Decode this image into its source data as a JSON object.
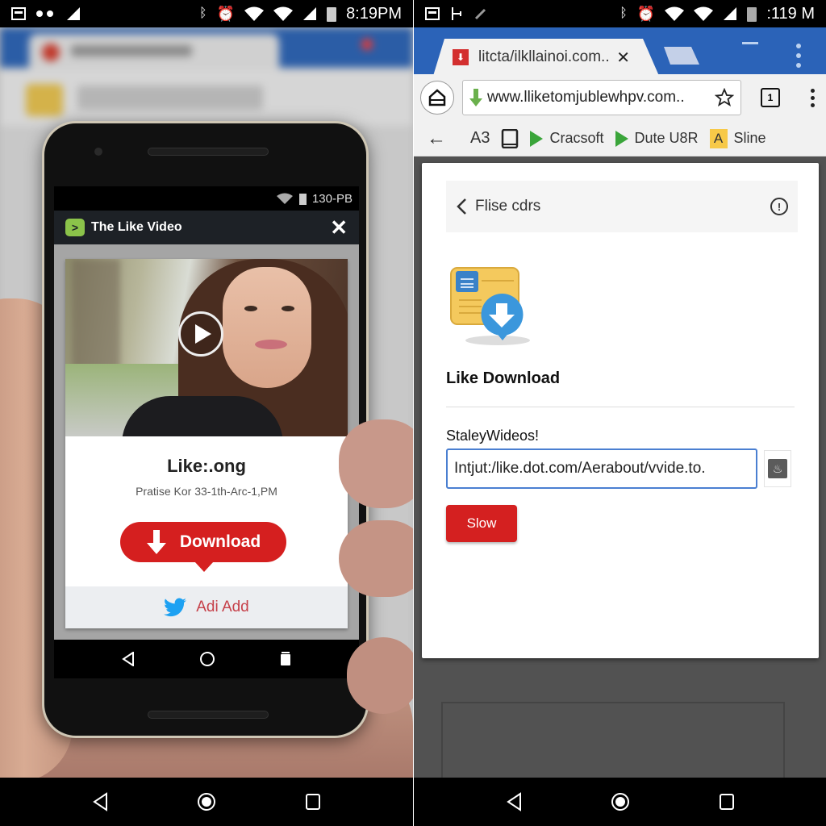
{
  "left_screen": {
    "status_bar": {
      "time": "8:19PM",
      "left_icons": [
        "screenshot-icon",
        "dots-icon",
        "signal-icon"
      ],
      "right_icons": [
        "bluetooth-icon",
        "alarm-icon",
        "wifi-icon",
        "wifi-icon",
        "signal-icon",
        "battery-icon"
      ]
    },
    "phone": {
      "status": {
        "text": "130-PB",
        "icons": [
          "wifi-icon",
          "signal-icon"
        ]
      },
      "app_header": {
        "title": "The Like Video",
        "logo_glyph": ">",
        "close_glyph": "✕"
      },
      "video": {
        "play_icon": "play-icon"
      },
      "card": {
        "title": "Like:.ong",
        "subtitle": "Pratise Kor 33-1th-Arc-1,PM",
        "download_label": "Download",
        "footer_label": "Adi Add",
        "footer_icon": "twitter-bird-icon"
      },
      "nav": [
        "back-icon",
        "home-icon",
        "recents-icon"
      ]
    },
    "nav_bar": [
      "back-icon",
      "home-icon",
      "recents-icon"
    ]
  },
  "right_screen": {
    "status_bar": {
      "time": ":119 M",
      "left_icons": [
        "screenshot-icon",
        "usb-icon",
        "edit-icon"
      ],
      "right_icons": [
        "bluetooth-icon",
        "alarm-icon",
        "wifi-icon",
        "wifi-icon",
        "signal-icon",
        "battery-icon"
      ]
    },
    "browser": {
      "tab": {
        "title": "litcta/ilkllainoi.com..",
        "close_glyph": "✕"
      },
      "url": "www.lliketomjublewhpv.com..",
      "tabs_count": "1",
      "bookmarks": [
        {
          "label": "",
          "icon": "back-arrow-icon",
          "glyph": "←"
        },
        {
          "label": "A3",
          "icon": "text-icon"
        },
        {
          "label": "",
          "icon": "tablet-icon"
        },
        {
          "label": "Cracsoft",
          "icon": "play-triangle-icon"
        },
        {
          "label": "Dute U8R",
          "icon": "play-triangle-icon"
        },
        {
          "label": "Sline",
          "icon": "a-badge-icon",
          "glyph": "A"
        }
      ]
    },
    "panel": {
      "back_label": "Flise cdrs",
      "info_glyph": "!",
      "title": "Like Download",
      "field_label": "StaleyWideos!",
      "url_value": "Intjut:/like.dot.com/Aerabout/vvide.to.",
      "paste_glyph": "♨",
      "submit_label": "Slow"
    },
    "nav_bar": [
      "back-icon",
      "home-icon",
      "recents-icon"
    ]
  },
  "colors": {
    "browser_blue": "#2b63b8",
    "download_red": "#d51f1f",
    "input_border": "#4a7fd1",
    "app_logo_green": "#8bc34a",
    "twitter_blue": "#1da1f2",
    "bookmark_green": "#3aa53a"
  }
}
